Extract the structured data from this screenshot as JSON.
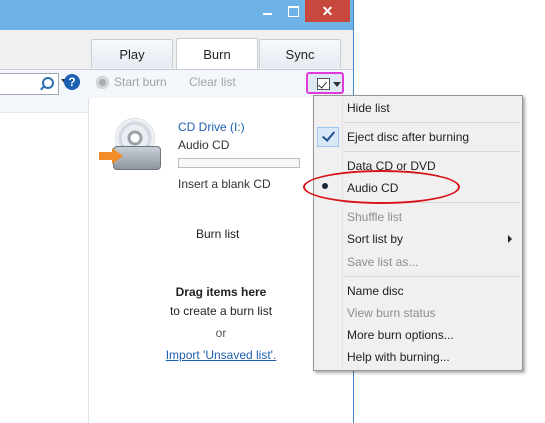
{
  "window": {
    "close_glyph": "✕"
  },
  "tabs": [
    {
      "label": "Play"
    },
    {
      "label": "Burn"
    },
    {
      "label": "Sync"
    }
  ],
  "toolbar": {
    "start_burn": "Start burn",
    "clear_list": "Clear list",
    "help_glyph": "?"
  },
  "burn_pane": {
    "drive_name": "CD Drive (I:)",
    "disc_type": "Audio CD",
    "insert_hint": "Insert a blank CD",
    "burn_list_title": "Burn list",
    "drag_title": "Drag items here",
    "drag_sub": "to create a burn list",
    "or": "or",
    "import_link": "Import 'Unsaved list'."
  },
  "menu": {
    "items": [
      {
        "label": "Hide list",
        "state": "enabled"
      },
      {
        "label": "Eject disc after burning",
        "state": "checked"
      },
      {
        "label": "Data CD or DVD",
        "state": "enabled"
      },
      {
        "label": "Audio CD",
        "state": "selected"
      },
      {
        "label": "Shuffle list",
        "state": "disabled"
      },
      {
        "label": "Sort list by",
        "state": "submenu"
      },
      {
        "label": "Save list as...",
        "state": "disabled"
      },
      {
        "label": "Name disc",
        "state": "enabled"
      },
      {
        "label": "View burn status",
        "state": "disabled"
      },
      {
        "label": "More burn options...",
        "state": "enabled"
      },
      {
        "label": "Help with burning...",
        "state": "enabled"
      }
    ]
  },
  "colors": {
    "highlight_annotation": "#e23ad8",
    "callout_annotation": "#d8141a",
    "link": "#1e5fb0",
    "close_button": "#c9483e"
  }
}
